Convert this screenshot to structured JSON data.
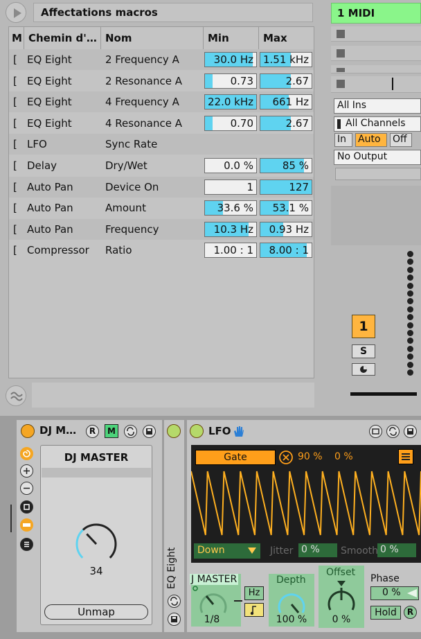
{
  "top": {
    "title": "Affectations macros"
  },
  "table": {
    "headers": [
      "M",
      "Chemin d'…",
      "Nom",
      "Min",
      "Max"
    ],
    "rows": [
      {
        "m": "[",
        "path": "EQ Eight",
        "name": "2 Frequency A",
        "min": "30.0 Hz",
        "max": "1.51 kHz",
        "min_fill": 0.93,
        "max_fill": 0.6
      },
      {
        "m": "[",
        "path": "EQ Eight",
        "name": "2 Resonance A",
        "min": "0.73",
        "max": "2.67",
        "min_fill": 0.15,
        "max_fill": 0.6
      },
      {
        "m": "[",
        "path": "EQ Eight",
        "name": "4 Frequency A",
        "min": "22.0 kHz",
        "max": "661 Hz",
        "min_fill": 1.0,
        "max_fill": 0.55
      },
      {
        "m": "[",
        "path": "EQ Eight",
        "name": "4 Resonance A",
        "min": "0.70",
        "max": "2.67",
        "min_fill": 0.15,
        "max_fill": 0.6
      },
      {
        "m": "[",
        "path": "LFO",
        "name": "Sync Rate",
        "min": "",
        "max": "",
        "min_fill": 0,
        "max_fill": 0
      },
      {
        "m": "[",
        "path": "Delay",
        "name": "Dry/Wet",
        "min": "0.0 %",
        "max": "85 %",
        "min_fill": 0,
        "max_fill": 0.85
      },
      {
        "m": "[",
        "path": "Auto Pan",
        "name": "Device On",
        "min": "1",
        "max": "127",
        "min_fill": 0,
        "max_fill": 1.0
      },
      {
        "m": "[",
        "path": "Auto Pan",
        "name": "Amount",
        "min": "33.6 %",
        "max": "53.1 %",
        "min_fill": 0.35,
        "max_fill": 0.55
      },
      {
        "m": "[",
        "path": "Auto Pan",
        "name": "Frequency",
        "min": "10.3 Hz",
        "max": "0.93 Hz",
        "min_fill": 0.85,
        "max_fill": 0.45
      },
      {
        "m": "[",
        "path": "Compressor",
        "name": "Ratio",
        "min": "1.00 : 1",
        "max": "8.00 : 1",
        "min_fill": 0,
        "max_fill": 0.9
      }
    ]
  },
  "mixer": {
    "track_name": "1 MIDI",
    "input_type": "All Ins",
    "input_channel": "All Channels",
    "monitor": [
      "In",
      "Auto",
      "Off"
    ],
    "monitor_selected": "Auto",
    "output": "No Output",
    "track_number": "1",
    "solo": "S"
  },
  "dj_device": {
    "title": "DJ M…",
    "r_btn": "R",
    "m_btn": "M",
    "macro_name": "DJ MASTER",
    "macro_value": "34",
    "unmap": "Unmap",
    "knob_level": 0.34
  },
  "eq_device": {
    "title": "EQ Eight"
  },
  "lfo_device": {
    "title": "LFO",
    "gate": "Gate",
    "gate_percent": "90 %",
    "offset_percent": "0 %",
    "shape": "Down",
    "jitter_label": "Jitter",
    "jitter": "0 %",
    "smooth_label": "Smooth",
    "smooth": "0 %",
    "rate_label": "J MASTER",
    "rate_value": "1/8",
    "hz_btn": "Hz",
    "depth_label": "Depth",
    "depth_value": "100 %",
    "offset_label": "Offset",
    "offset_value": "0 %",
    "phase_label": "Phase",
    "phase_value": "0 %",
    "hold": "Hold",
    "r_btn": "R",
    "wave_color": "#ffb020"
  }
}
